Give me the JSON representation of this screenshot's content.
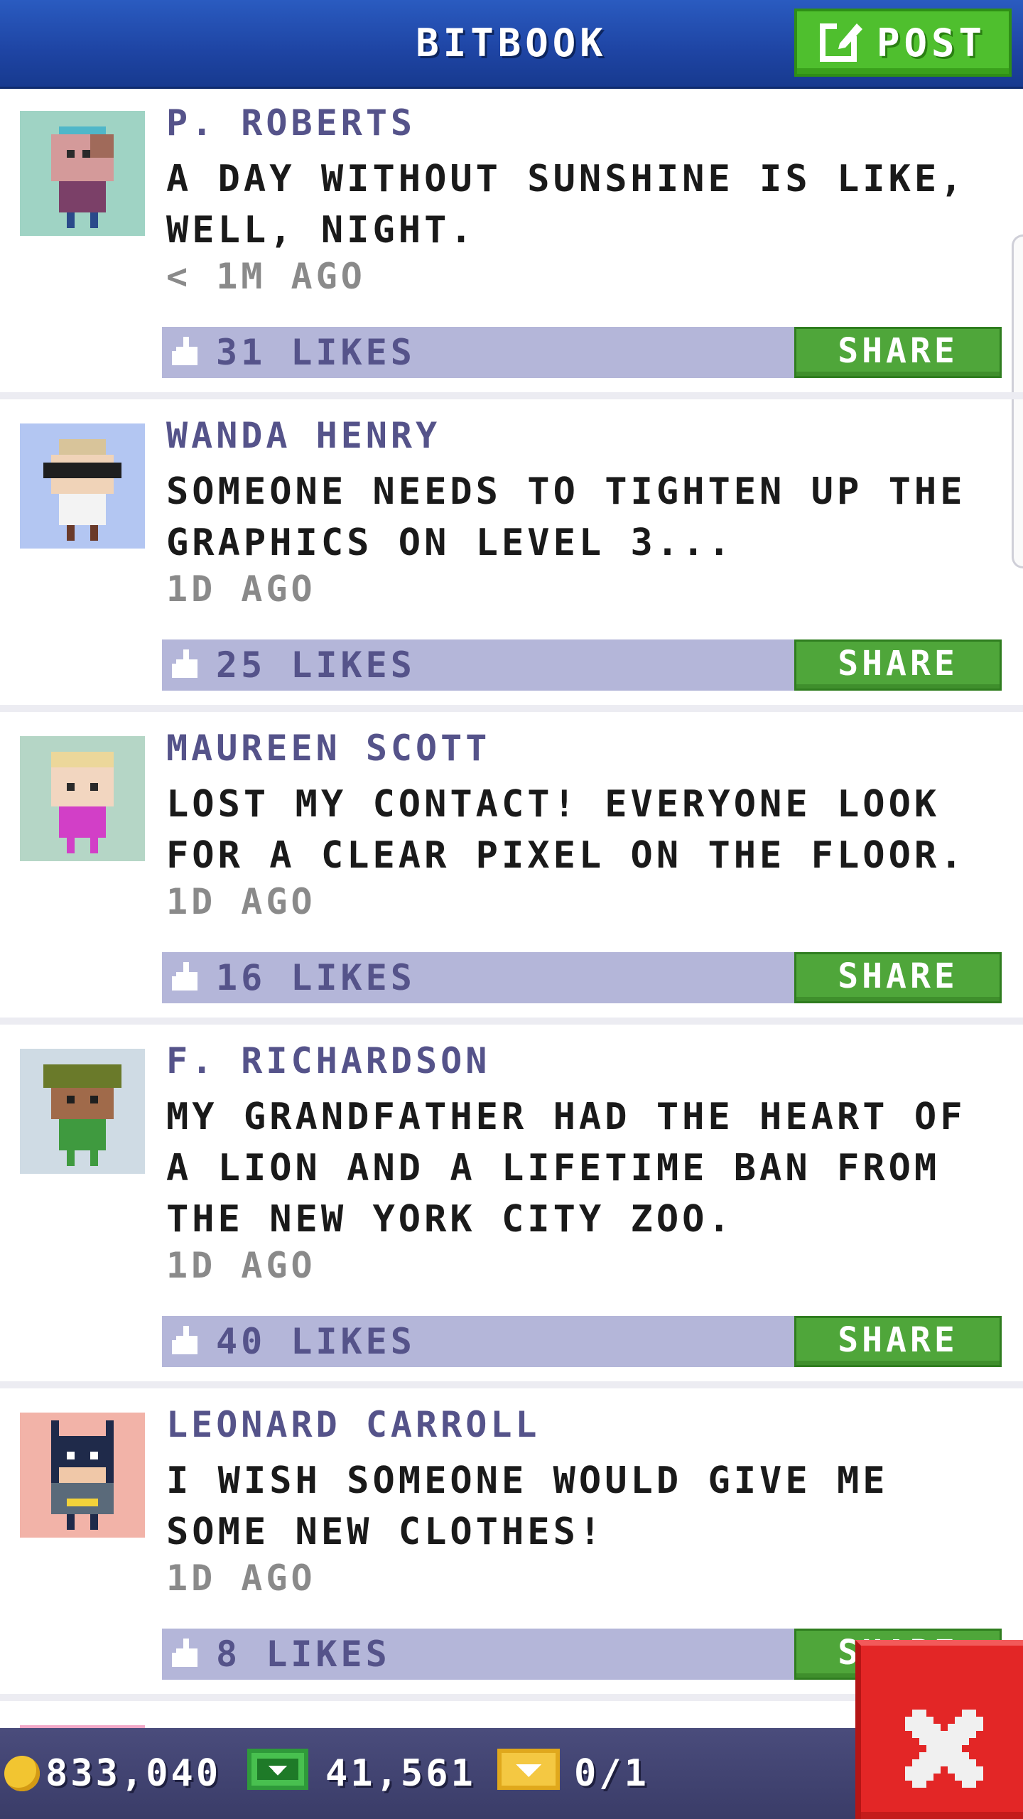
{
  "header": {
    "title": "BITBOOK",
    "post_label": "POST"
  },
  "posts": [
    {
      "author": "P. ROBERTS",
      "text": "A DAY WITHOUT SUNSHINE IS LIKE, WELL, NIGHT.",
      "time": "< 1M AGO",
      "likes": "31 LIKES",
      "share": "SHARE"
    },
    {
      "author": "WANDA HENRY",
      "text": "SOMEONE NEEDS TO TIGHTEN UP THE GRAPHICS ON LEVEL 3...",
      "time": "1D AGO",
      "likes": "25 LIKES",
      "share": "SHARE"
    },
    {
      "author": "MAUREEN SCOTT",
      "text": "LOST MY CONTACT! EVERYONE LOOK FOR A CLEAR PIXEL ON THE FLOOR.",
      "time": "1D AGO",
      "likes": "16 LIKES",
      "share": "SHARE"
    },
    {
      "author": "F. RICHARDSON",
      "text": "MY GRANDFATHER HAD THE HEART OF A LION AND A LIFETIME BAN FROM THE NEW YORK CITY ZOO.",
      "time": "1D AGO",
      "likes": "40 LIKES",
      "share": "SHARE"
    },
    {
      "author": "LEONARD CARROLL",
      "text": "I WISH SOMEONE WOULD GIVE ME SOME NEW CLOTHES!",
      "time": "1D AGO",
      "likes": "8 LIKES",
      "share": "SHARE"
    }
  ],
  "footer": {
    "coins": "833,040",
    "bux": "41,561",
    "tickets": "0/1"
  },
  "colors": {
    "header": "#1e44a3",
    "accent_green": "#4fa63a",
    "likes_bar": "#b4b6d9",
    "author_text": "#55538a",
    "close": "#e32626"
  }
}
